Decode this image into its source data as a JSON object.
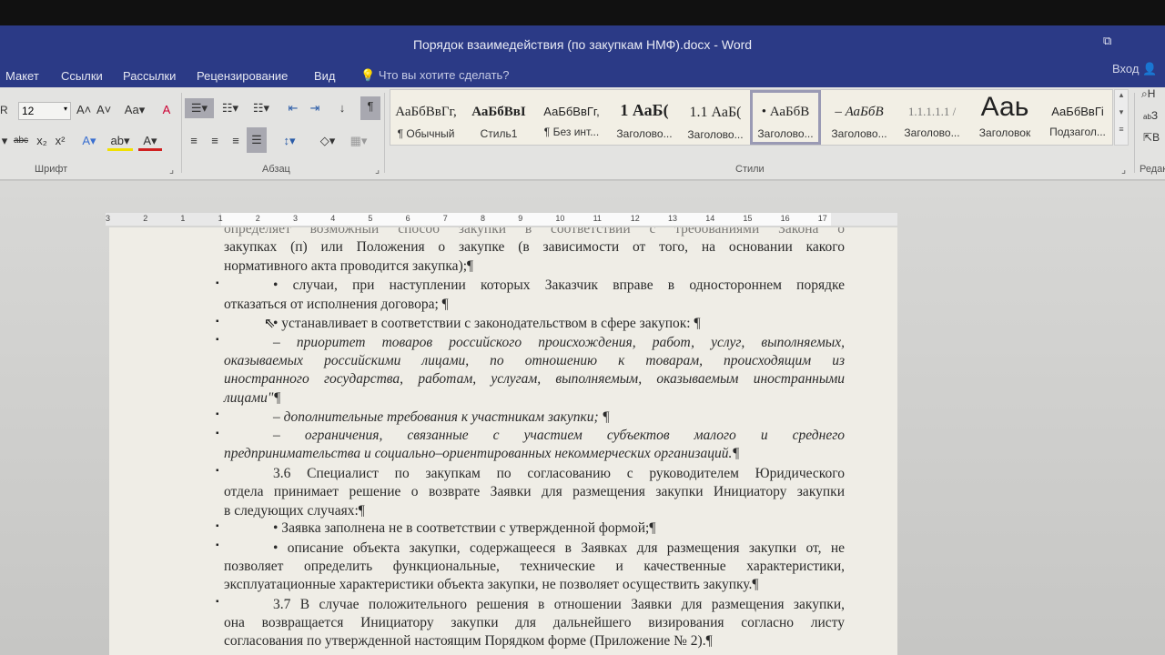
{
  "window": {
    "title": "Порядок взаимедействия (по закупкам НМФ).docx - Word",
    "login": "Вход",
    "restore_icon": "restore-icon"
  },
  "tabs": [
    "Макет",
    "Ссылки",
    "Рассылки",
    "Рецензирование",
    "Вид"
  ],
  "tell_me": "Что вы хотите сделать?",
  "ribbon": {
    "font": {
      "name_partial": "R",
      "size": "12",
      "change_case": "Aa",
      "group": "Шрифт"
    },
    "paragraph": {
      "group": "Абзац"
    },
    "styles": {
      "group": "Стили",
      "items": [
        {
          "preview": "АаБбВвГг,",
          "name": "¶ Обычный"
        },
        {
          "preview": "АаБбВвI",
          "name": "Стиль1"
        },
        {
          "preview": "АаБбВвГг,",
          "name": "¶ Без инт..."
        },
        {
          "preview": "1  АаБ(",
          "name": "Заголово..."
        },
        {
          "preview": "1.1  АаБ(",
          "name": "Заголово..."
        },
        {
          "preview": "• АаБбВ",
          "name": "Заголово...",
          "selected": true
        },
        {
          "preview": "– АаБбВ",
          "name": "Заголово..."
        },
        {
          "preview": "1.1.1.1.1 /",
          "name": "Заголово..."
        },
        {
          "preview": "Ааь",
          "name": "Заголовок"
        },
        {
          "preview": "АаБбВвГі",
          "name": "Подзагол..."
        }
      ]
    },
    "editing": {
      "group": "Редак",
      "find": "Н",
      "replace": "З",
      "select": "В"
    }
  },
  "ruler": {
    "labels": [
      "3",
      "2",
      "1",
      "1",
      "2",
      "3",
      "4",
      "5",
      "6",
      "7",
      "8",
      "9",
      "10",
      "11",
      "12",
      "13",
      "14",
      "15",
      "16",
      "17"
    ]
  },
  "doc": {
    "lines": [
      "определяет возможный способ закупки в соответствии с требованиями Закона о",
      "закупках (п) или Положения о закупке (в зависимости от того, на основании какого",
      "нормативного акта проводится закупка);¶",
      "• случаи, при наступлении которых Заказчик вправе в одностороннем порядке",
      "отказаться от исполнения договора; ¶",
      "• устанавливает в соответствии с законодательством в сфере закупок: ¶",
      "– приоритет товаров российского происхождения, работ, услуг, выполняемых,",
      "оказываемых российскими лицами, по отношению к товарам, происходящим из",
      "иностранного государства, работам, услугам, выполняемым, оказываемым иностранными",
      "лицами\"¶",
      "– дополнительные требования к участникам закупки; ¶",
      "– ограничения, связанные с участием субъектов малого и среднего",
      "предпринимательства и социально–ориентированных некоммерческих организаций.¶",
      "3.6 Специалист по закупкам по согласованию с руководителем Юридического",
      "отдела принимает решение о возврате Заявки для размещения закупки Инициатору закупки",
      "в следующих случаях:¶",
      "• Заявка заполнена не в соответствии с утвержденной формой;¶",
      "• описание объекта закупки, содержащееся в Заявках для размещения закупки от, не",
      "позволяет определить функциональные, технические и качественные характеристики,",
      "эксплуатационные характеристики объекта закупки, не позволяет осуществить закупку.¶",
      "3.7 В случае положительного решения в отношении Заявки для размещения закупки,",
      "она возвращается Инициатору закупки для дальнейшего визирования согласно листу",
      "согласования по утвержденной настоящим Порядком форме (Приложение № 2).¶"
    ]
  }
}
